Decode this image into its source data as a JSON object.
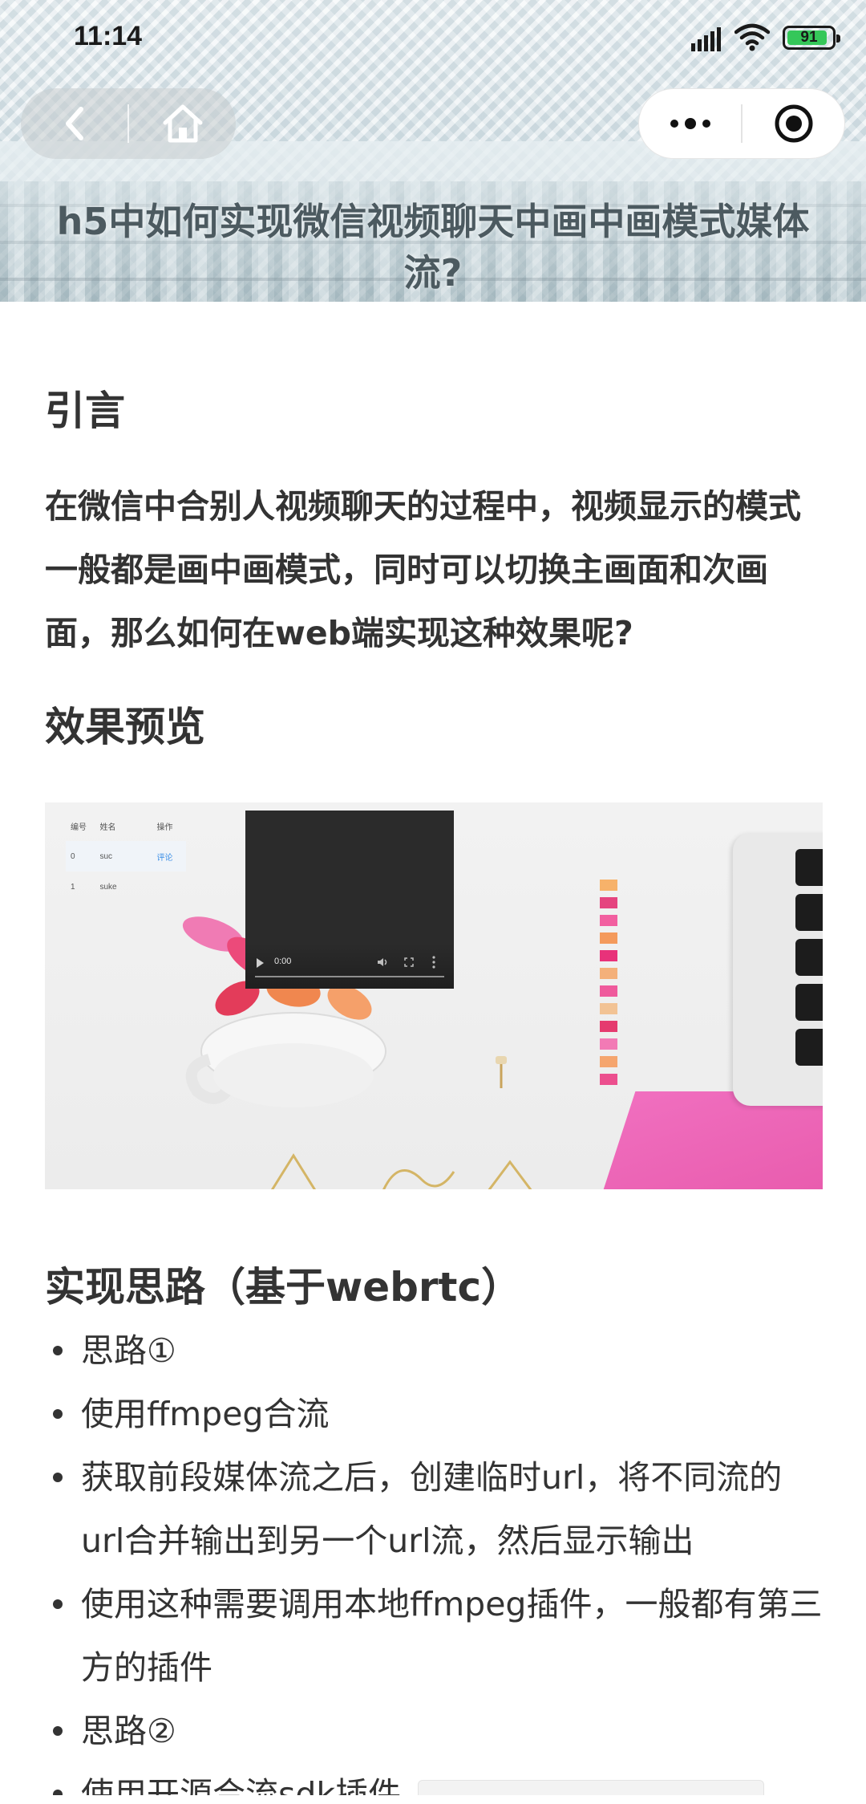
{
  "status_bar": {
    "time": "11:14",
    "battery_level": "91",
    "battery_fraction": 0.91,
    "icons": [
      "signal-icon",
      "wifi-icon",
      "battery-icon"
    ]
  },
  "nav": {
    "back_icon": "chevron-left-icon",
    "home_icon": "home-icon",
    "more_icon": "more-dots-icon",
    "close_icon": "target-circle-icon"
  },
  "header": {
    "title": "h5中如何实现微信视频聊天中画中画模式媒体流?"
  },
  "article": {
    "intro_heading": "引言",
    "intro_paragraph": "在微信中合别人视频聊天的过程中，视频显示的模式一般都是画中画模式，同时可以切换主画面和次画面，那么如何在web端实现这种效果呢?",
    "preview_heading": "效果预览",
    "preview_image": {
      "table_headers": [
        "编号",
        "姓名",
        "操作"
      ],
      "table_rows": [
        [
          "0",
          "suc",
          "评论"
        ],
        [
          "1",
          "suke",
          ""
        ]
      ],
      "video_time": "0:00"
    },
    "approach_heading": "实现思路（基于webrtc）",
    "bullets": [
      "思路①",
      "使用ffmpeg合流",
      "获取前段媒体流之后，创建临时url，将不同流的url合并输出到另一个url流，然后显示输出",
      "使用这种需要调用本地ffmpeg插件，一般都有第三方的插件",
      "思路②",
      "使用开源合流sdk插件"
    ]
  },
  "colors": {
    "text": "#333333",
    "battery_fill": "#35c759",
    "link_blue": "#3a8ee6"
  }
}
